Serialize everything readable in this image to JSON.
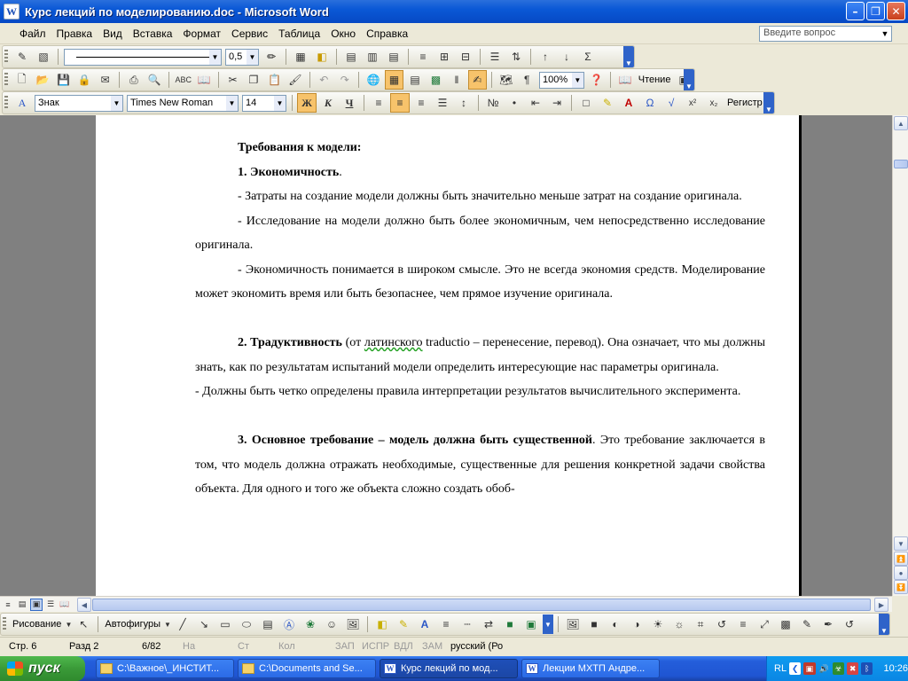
{
  "window": {
    "title": "Курс лекций по моделированию.doc - Microsoft Word"
  },
  "menu": {
    "items": [
      "Файл",
      "Правка",
      "Вид",
      "Вставка",
      "Формат",
      "Сервис",
      "Таблица",
      "Окно",
      "Справка"
    ],
    "ask_placeholder": "Введите вопрос"
  },
  "toolbar_table": {
    "line_width": "0,5"
  },
  "toolbar_standard": {
    "zoom": "100%",
    "reading_label": "Чтение"
  },
  "toolbar_format": {
    "style": "Знак",
    "font": "Times New Roman",
    "size": "14",
    "register_label": "Регистр"
  },
  "document": {
    "p1": "Требования к модели:",
    "p2_bold": "1. Экономичность",
    "p2_rest": ".",
    "p3": "- Затраты на создание модели должны быть значительно меньше затрат на создание оригинала.",
    "p4": "- Исследование на модели должно быть более экономичным, чем непосредственно исследование оригинала.",
    "p5": "- Экономичность понимается в широком смысле. Это не всегда экономия средств. Моделирование может экономить время или быть безопаснее, чем прямое изучение оригинала.",
    "p6_bold": "2. Традуктивность",
    "p6_a": " (от ",
    "p6_wavy": "латинского",
    "p6_b": " traductio – перенесение, перевод). Она означает, что мы должны знать, как по результатам испытаний модели определить интересующие нас параметры оригинала.",
    "p7": "- Должны быть четко определены правила интерпретации результатов вычислительного эксперимента.",
    "p8_bold": "3. Основное требование – модель должна быть существенной",
    "p8_rest": ". Это требование заключается в том, что модель должна отражать необходимые, существенные для решения конкретной задачи свойства объекта. Для одного и того же объекта сложно создать обоб-"
  },
  "drawing_toolbar": {
    "draw_label": "Рисование",
    "autoshapes_label": "Автофигуры"
  },
  "status": {
    "page": "Стр. 6",
    "section": "Разд 2",
    "pages": "6/82",
    "at": "На",
    "line": "Ст",
    "col": "Кол",
    "rec": "ЗАП",
    "trk": "ИСПР",
    "ext": "ВДЛ",
    "ovr": "ЗАМ",
    "lang": "русский (Ро"
  },
  "taskbar": {
    "start_label": "пуск",
    "tasks": [
      "C:\\Важное\\_ИНСТИТ...",
      "C:\\Documents and Se...",
      "Курс лекций по мод...",
      "Лекции МХТП Андре..."
    ],
    "lang": "RL",
    "clock": "10:26"
  }
}
